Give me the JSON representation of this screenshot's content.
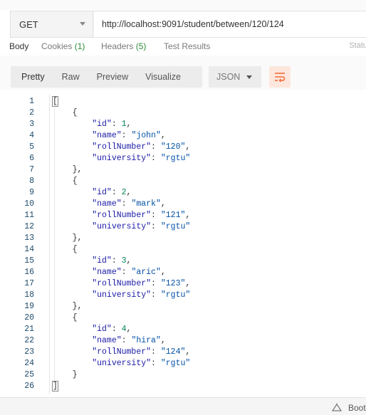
{
  "request": {
    "method": "GET",
    "url": "http://localhost:9091/student/between/120/124"
  },
  "response_tabs": [
    {
      "label": "Body",
      "count": ""
    },
    {
      "label": "Cookies",
      "count": "(1)"
    },
    {
      "label": "Headers",
      "count": "(5)"
    },
    {
      "label": "Test Results",
      "count": ""
    }
  ],
  "status_label": "Statu",
  "view_modes": [
    "Pretty",
    "Raw",
    "Preview",
    "Visualize"
  ],
  "format": "JSON",
  "bottom": {
    "label": "Boot"
  },
  "colors": {
    "accent": "#f26b3a",
    "wrap_bg": "#fde7dd"
  },
  "json_lines": [
    "[",
    "    {",
    "        \"id\": 1,",
    "        \"name\": \"john\",",
    "        \"rollNumber\": \"120\",",
    "        \"university\": \"rgtu\"",
    "    },",
    "    {",
    "        \"id\": 2,",
    "        \"name\": \"mark\",",
    "        \"rollNumber\": \"121\",",
    "        \"university\": \"rgtu\"",
    "    },",
    "    {",
    "        \"id\": 3,",
    "        \"name\": \"aric\",",
    "        \"rollNumber\": \"123\",",
    "        \"university\": \"rgtu\"",
    "    },",
    "    {",
    "        \"id\": 4,",
    "        \"name\": \"hira\",",
    "        \"rollNumber\": \"124\",",
    "        \"university\": \"rgtu\"",
    "    }",
    "]"
  ]
}
